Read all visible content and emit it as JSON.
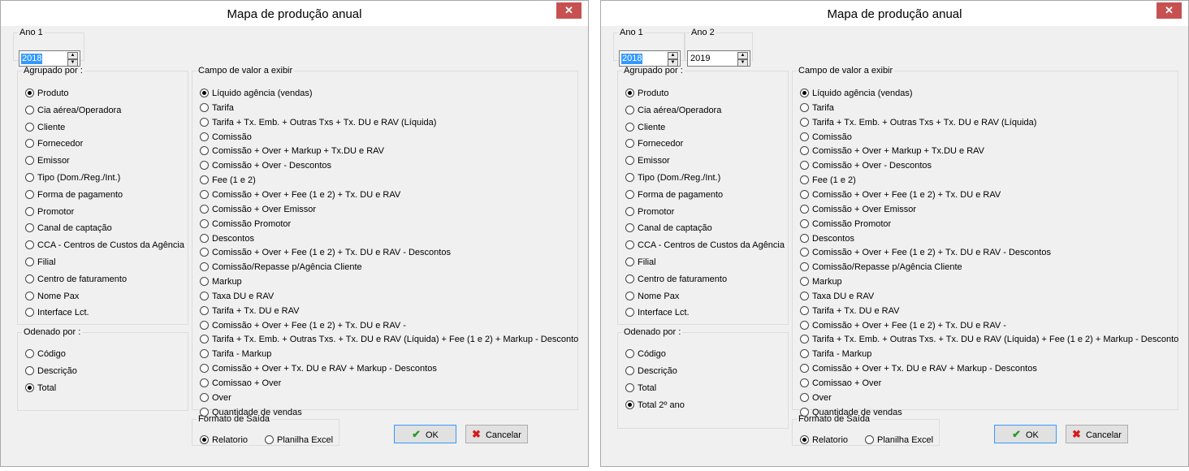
{
  "dialogs": [
    {
      "title": "Mapa de produção anual",
      "close_symbol": "✕",
      "ano1": {
        "label": "Ano 1",
        "value": "2018"
      },
      "ano2": null,
      "agrupado": {
        "label": "Agrupado por :",
        "items": [
          "Produto",
          "Cia aérea/Operadora",
          "Cliente",
          "Fornecedor",
          "Emissor",
          "Tipo (Dom./Reg./Int.)",
          "Forma de pagamento",
          "Promotor",
          "Canal de captação",
          "CCA - Centros de Custos da Agência",
          "Filial",
          "Centro de faturamento",
          "Nome Pax",
          "Interface Lct."
        ],
        "selected": 0
      },
      "ordenado": {
        "label": "Odenado por :",
        "items": [
          "Código",
          "Descrição",
          "Total"
        ],
        "selected": 2
      },
      "campo": {
        "label": "Campo de valor a exibir",
        "items": [
          "Líquido agência (vendas)",
          "Tarifa",
          "Tarifa + Tx. Emb. + Outras Txs + Tx. DU e RAV (Líquida)",
          "Comissão",
          "Comissão + Over + Markup + Tx.DU e RAV",
          "Comissão + Over - Descontos",
          "Fee (1 e 2)",
          "Comissão + Over + Fee (1 e 2) + Tx. DU e RAV",
          "Comissão + Over Emissor",
          "Comissão Promotor",
          "Descontos",
          "Comissão + Over + Fee (1 e 2) + Tx. DU e RAV - Descontos",
          "Comissão/Repasse p/Agência Cliente",
          "Markup",
          "Taxa DU e RAV",
          "Tarifa + Tx. DU e RAV",
          "Comissão + Over + Fee (1 e 2) + Tx. DU e RAV -",
          "Tarifa + Tx. Emb. + Outras Txs. + Tx. DU e RAV (Líquida) + Fee (1 e 2) + Markup - Desconto",
          "Tarifa - Markup",
          "Comissão + Over + Tx. DU e RAV + Markup - Descontos",
          "Comissao + Over",
          "Over",
          "Quantidade de vendas"
        ],
        "selected": 0
      },
      "formato": {
        "label": "Formato de Saída",
        "items": [
          "Relatorio",
          "Planilha Excel"
        ],
        "selected": 0
      },
      "ok_label": "OK",
      "cancel_label": "Cancelar"
    },
    {
      "title": "Mapa de produção anual",
      "close_symbol": "✕",
      "ano1": {
        "label": "Ano 1",
        "value": "2018"
      },
      "ano2": {
        "label": "Ano 2",
        "value": "2019"
      },
      "agrupado": {
        "label": "Agrupado por :",
        "items": [
          "Produto",
          "Cia aérea/Operadora",
          "Cliente",
          "Fornecedor",
          "Emissor",
          "Tipo (Dom./Reg./Int.)",
          "Forma de pagamento",
          "Promotor",
          "Canal de captação",
          "CCA - Centros de Custos da Agência",
          "Filial",
          "Centro de faturamento",
          "Nome Pax",
          "Interface Lct."
        ],
        "selected": 0
      },
      "ordenado": {
        "label": "Odenado por :",
        "items": [
          "Código",
          "Descrição",
          "Total",
          "Total 2º ano"
        ],
        "selected": 3
      },
      "campo": {
        "label": "Campo de valor a exibir",
        "items": [
          "Líquido agência (vendas)",
          "Tarifa",
          "Tarifa + Tx. Emb. + Outras Txs + Tx. DU e RAV (Líquida)",
          "Comissão",
          "Comissão + Over + Markup + Tx.DU e RAV",
          "Comissão + Over - Descontos",
          "Fee (1 e 2)",
          "Comissão + Over + Fee (1 e 2) + Tx. DU e RAV",
          "Comissão + Over Emissor",
          "Comissão Promotor",
          "Descontos",
          "Comissão + Over + Fee (1 e 2) + Tx. DU e RAV - Descontos",
          "Comissão/Repasse p/Agência Cliente",
          "Markup",
          "Taxa DU e RAV",
          "Tarifa + Tx. DU e RAV",
          "Comissão + Over + Fee (1 e 2) + Tx. DU e RAV -",
          "Tarifa + Tx. Emb. + Outras Txs. + Tx. DU e RAV (Líquida) + Fee (1 e 2) + Markup - Desconto",
          "Tarifa - Markup",
          "Comissão + Over + Tx. DU e RAV + Markup - Descontos",
          "Comissao + Over",
          "Over",
          "Quantidade de vendas"
        ],
        "selected": 0
      },
      "formato": {
        "label": "Formato de Saída",
        "items": [
          "Relatorio",
          "Planilha Excel"
        ],
        "selected": 0
      },
      "ok_label": "OK",
      "cancel_label": "Cancelar"
    }
  ]
}
